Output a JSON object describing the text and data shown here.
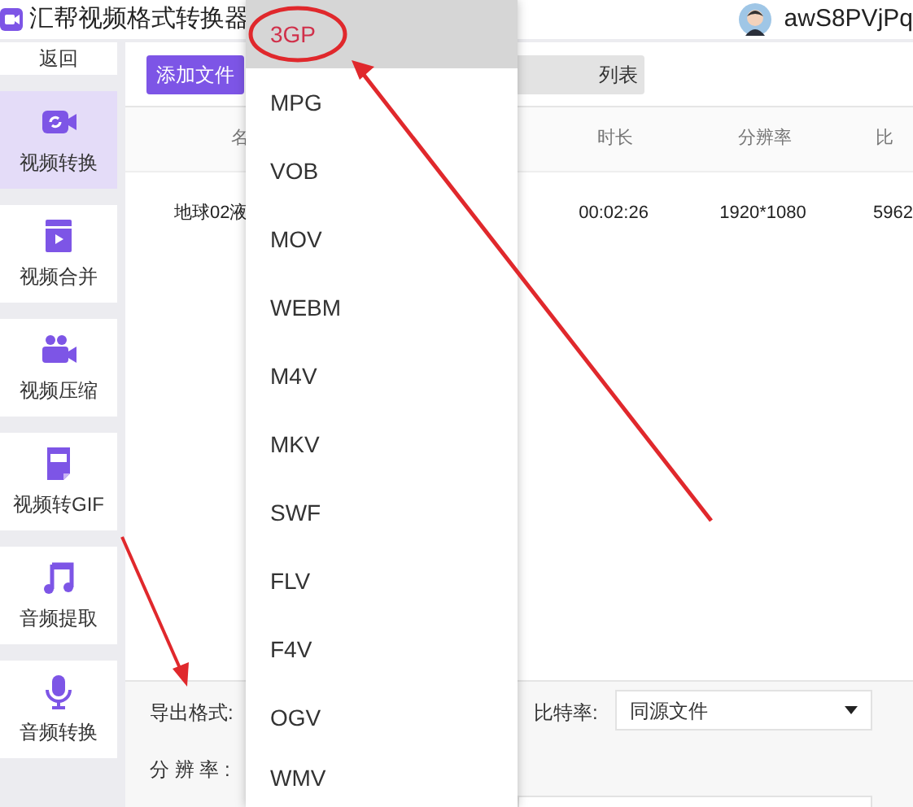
{
  "app": {
    "title": "汇帮视频格式转换器",
    "username": "awS8PVjPq"
  },
  "sidebar": {
    "back": "返回",
    "items": [
      {
        "label": "视频转换",
        "selected": true
      },
      {
        "label": "视频合并",
        "selected": false
      },
      {
        "label": "视频压缩",
        "selected": false
      },
      {
        "label": "视频转GIF",
        "selected": false
      },
      {
        "label": "音频提取",
        "selected": false
      },
      {
        "label": "音频转换",
        "selected": false
      }
    ]
  },
  "toolbar": {
    "add_button": "添加文件",
    "list_button": "列表"
  },
  "table": {
    "columns": [
      "名",
      "时长",
      "分辨率",
      "比"
    ],
    "rows": [
      [
        "地球02液",
        "00:02:26",
        "1920*1080",
        "5962"
      ]
    ]
  },
  "settings": {
    "format_label": "导出格式:",
    "bitrate_label": "比特率:",
    "bitrate_value": "同源文件",
    "resolution_label": "分 辨 率 :"
  },
  "format_menu": [
    {
      "label": "3GP",
      "selected": true
    },
    {
      "label": "MPG",
      "selected": false
    },
    {
      "label": "VOB",
      "selected": false
    },
    {
      "label": "MOV",
      "selected": false
    },
    {
      "label": "WEBM",
      "selected": false
    },
    {
      "label": "M4V",
      "selected": false
    },
    {
      "label": "MKV",
      "selected": false
    },
    {
      "label": "SWF",
      "selected": false
    },
    {
      "label": "FLV",
      "selected": false
    },
    {
      "label": "F4V",
      "selected": false
    },
    {
      "label": "OGV",
      "selected": false
    },
    {
      "label": "WMV",
      "selected": false
    }
  ]
}
